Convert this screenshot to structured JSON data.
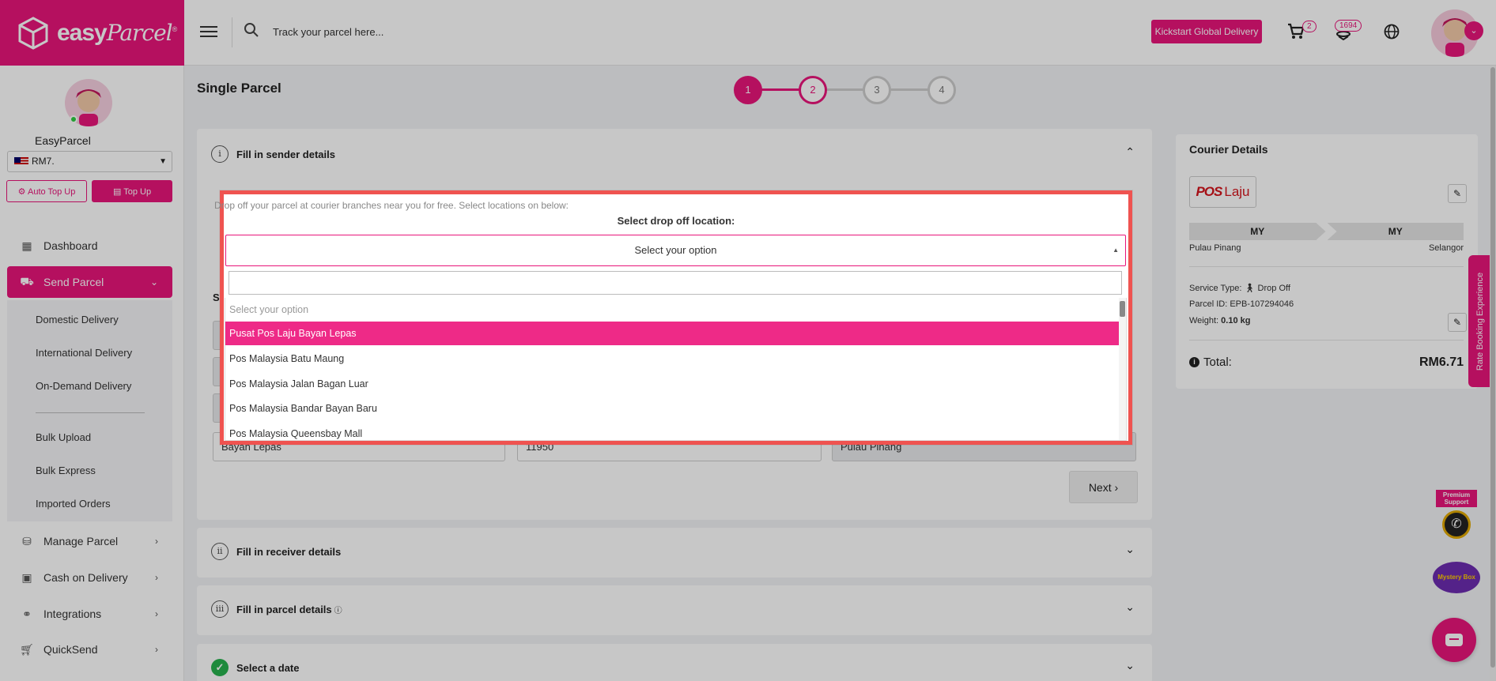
{
  "topbar": {
    "brand_name": "easy",
    "brand_name_script": "Parcel",
    "brand_mark": "®",
    "search_placeholder": "Track your parcel here...",
    "kickstart_label": "Kickstart Global Delivery",
    "cart_count": "2",
    "coin_count": "1694",
    "accent_color": "#e8157a"
  },
  "sidebar": {
    "user_name": "EasyParcel",
    "balance": "RM7.",
    "auto_topup_label": "Auto Top Up",
    "topup_label": "Top Up",
    "nav": [
      {
        "label": "Dashboard",
        "icon": "grid-icon"
      },
      {
        "label": "Send Parcel",
        "icon": "truck-icon",
        "active": true
      },
      {
        "label": "Manage Parcel",
        "icon": "boxes-icon"
      },
      {
        "label": "Cash on Delivery",
        "icon": "cash-icon"
      },
      {
        "label": "Integrations",
        "icon": "link-icon"
      },
      {
        "label": "QuickSend",
        "icon": "cart-icon"
      }
    ],
    "subnav": [
      "Domestic Delivery",
      "International Delivery",
      "On-Demand Delivery",
      "Bulk Upload",
      "Bulk Express",
      "Imported Orders"
    ]
  },
  "main": {
    "page_title": "Single Parcel",
    "steps": [
      "1",
      "2",
      "3",
      "4"
    ],
    "sender": {
      "roman": "i",
      "title": "Fill in sender details",
      "section_letter": "Se",
      "city": "Bayan Lepas",
      "postcode": "11950",
      "state": "Pulau Pinang",
      "next_label": "Next"
    },
    "receiver": {
      "roman": "ii",
      "title": "Fill in receiver details"
    },
    "parcel": {
      "roman": "iii",
      "title": "Fill in parcel details"
    },
    "date": {
      "title": "Select a date"
    }
  },
  "courier": {
    "title": "Courier Details",
    "logo_left": "POS",
    "logo_right": "Laju",
    "from_country": "MY",
    "to_country": "MY",
    "from_state": "Pulau Pinang",
    "to_state": "Selangor",
    "service_type": "Service Type:",
    "service_value": "Drop Off",
    "parcel_id": "Parcel ID:  EPB-107294046",
    "weight_label": "Weight:",
    "weight_value": "0.10 kg",
    "total_label": "Total:",
    "total_value": "RM6.71"
  },
  "widgets": {
    "rate_tab": "Rate Booking Experience",
    "premium_label": "Premium Support",
    "mystery_label": "Mystery Box"
  },
  "dropdown": {
    "note": "Drop off your parcel at courier branches near you for free. Select locations on below:",
    "label": "Select drop off location:",
    "selected": "Select your option",
    "search_value": "",
    "options": [
      "Select your option",
      "Pusat Pos Laju Bayan Lepas",
      "Pos Malaysia Batu Maung",
      "Pos Malaysia Jalan Bagan Luar",
      "Pos Malaysia Bandar Bayan Baru",
      "Pos Malaysia Queensbay Mall"
    ],
    "highlighted_index": 1,
    "border_color": "#ef5350"
  }
}
